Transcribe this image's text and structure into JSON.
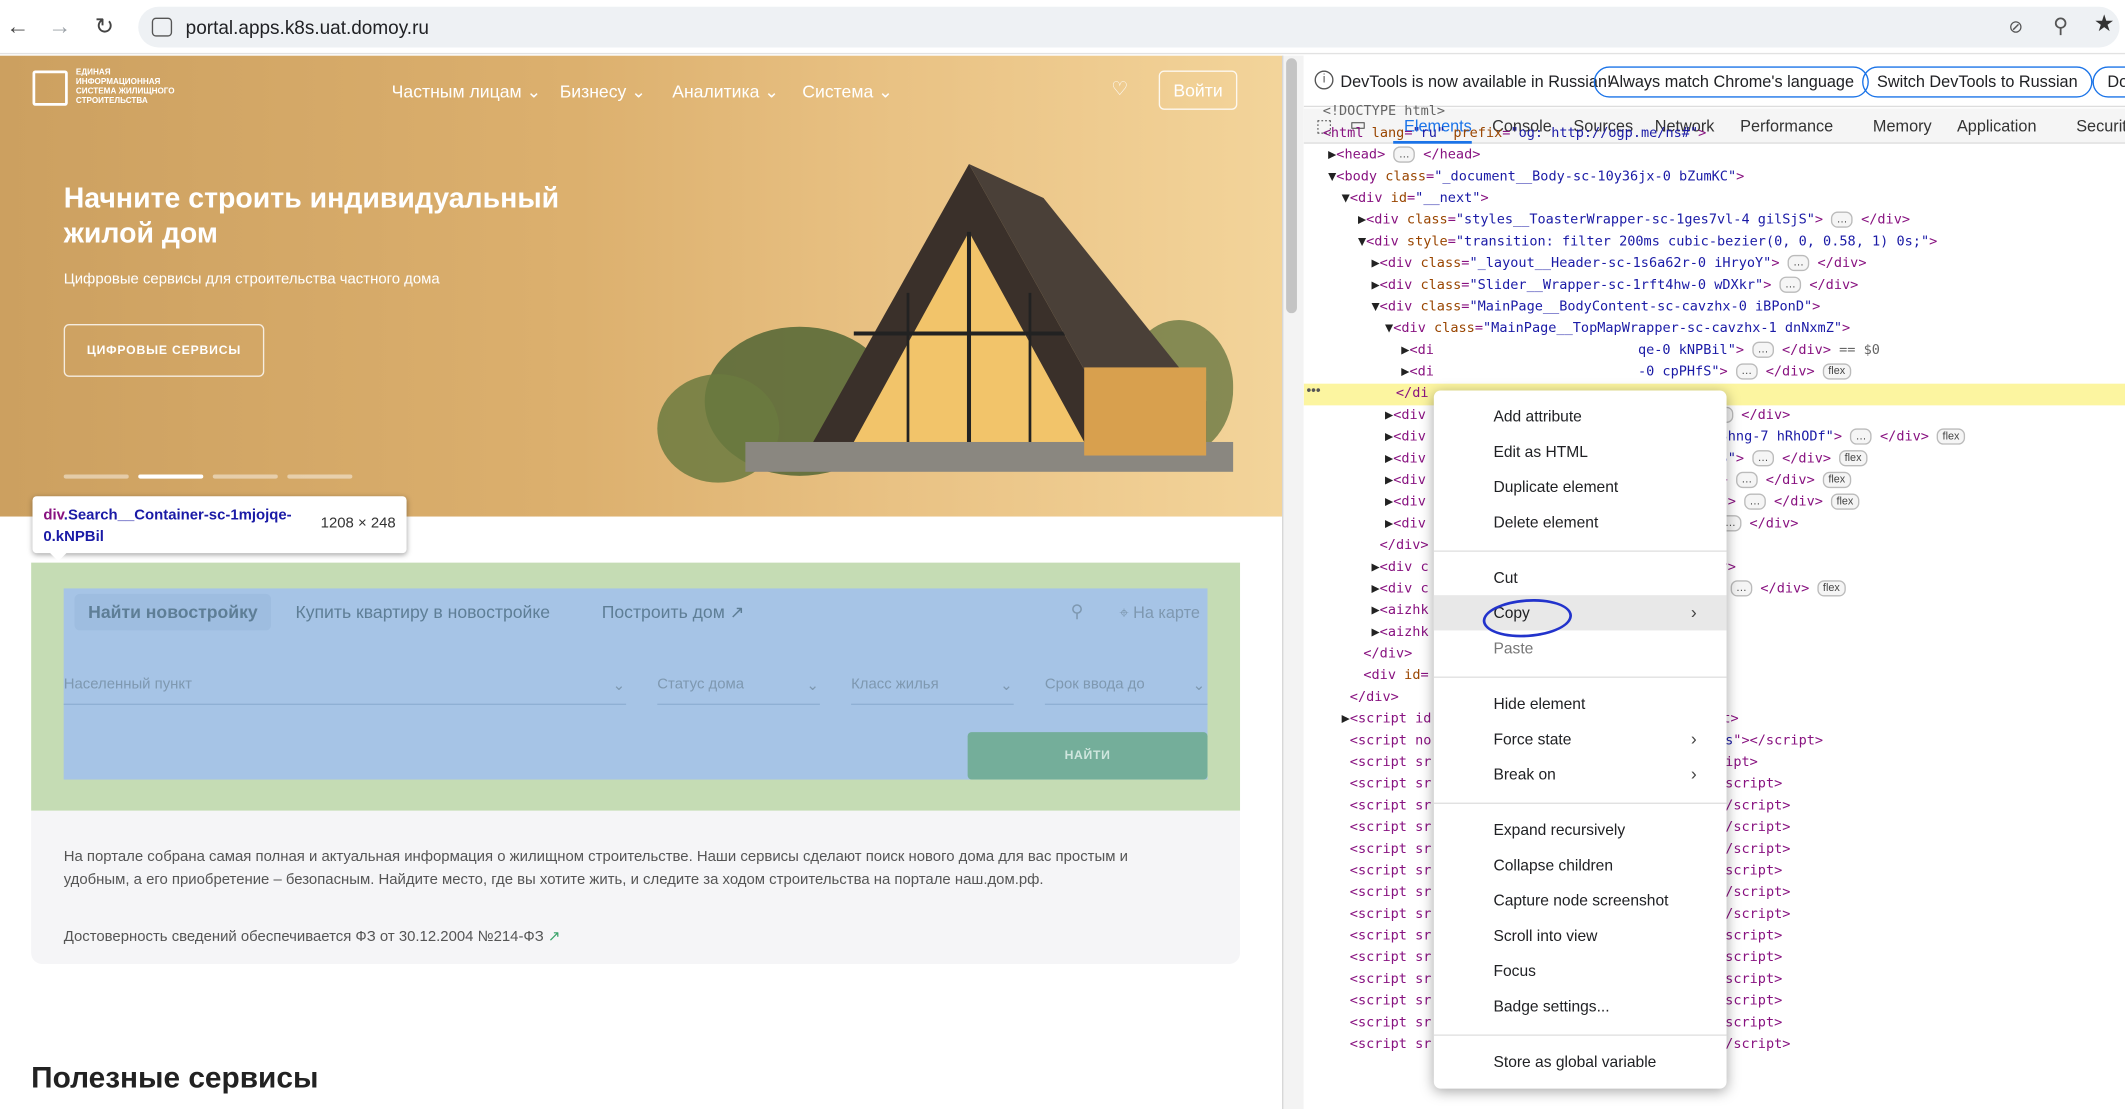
{
  "browser": {
    "url": "portal.apps.k8s.uat.domoy.ru"
  },
  "site": {
    "logo_text": "ЕДИНАЯ ИНФОРМАЦИОННАЯ СИСТЕМА ЖИЛИЩНОГО СТРОИТЕЛЬСТВА",
    "nav": [
      "Частным лицам",
      "Бизнесу",
      "Аналитика",
      "Система"
    ],
    "login_label": "Войти",
    "hero_title": "Начните строить индивидуальный жилой дом",
    "hero_subtitle": "Цифровые сервисы для строительства частного дома",
    "hero_button": "ЦИФРОВЫЕ СЕРВИСЫ",
    "search_tabs": [
      "Найти новостройку",
      "Купить квартиру в новостройке",
      "Построить дом"
    ],
    "map_link": "На карте",
    "filters": [
      "Населенный пункт",
      "Статус дома",
      "Класс жилья",
      "Срок ввода до"
    ],
    "find_button": "НАЙТИ",
    "info_text": "На портале собрана самая полная и актуальная информация о жилищном строительстве. Наши сервисы сделают поиск нового дома для вас простым и удобным, а его приобретение – безопасным. Найдите место, где вы хотите жить, и следите за ходом строительства на портале наш.дом.рф.",
    "law_text": "Достоверность сведений обеспечивается ФЗ от 30.12.2004 №214-ФЗ",
    "services_title": "Полезные сервисы"
  },
  "tooltip": {
    "tag": "div",
    "class": ".Search__Container-sc-1mjojqe-0.kNPBil",
    "size": "1208 × 248"
  },
  "devtools": {
    "banner": "DevTools is now available in Russian!",
    "banner_btn1": "Always match Chrome's language",
    "banner_btn2": "Switch DevTools to Russian",
    "banner_btn3": "Do",
    "tabs": [
      "Elements",
      "Console",
      "Sources",
      "Network",
      "Performance",
      "Memory",
      "Application",
      "Security"
    ],
    "active_tab": "Elements"
  },
  "context_menu": {
    "items": [
      "Add attribute",
      "Edit as HTML",
      "Duplicate element",
      "Delete element",
      "Cut",
      "Copy",
      "Paste",
      "Hide element",
      "Force state",
      "Break on",
      "Expand recursively",
      "Collapse children",
      "Capture node screenshot",
      "Scroll into view",
      "Focus",
      "Badge settings...",
      "Store as global variable"
    ]
  },
  "colors": {
    "hero_gold": "#d9ad6b",
    "search_margin": "#c5dcb4",
    "search_content": "#a6c4e6",
    "devtools_accent": "#1a73e8",
    "selected_row": "#fcf5a0",
    "annotation": "#2233cc"
  }
}
